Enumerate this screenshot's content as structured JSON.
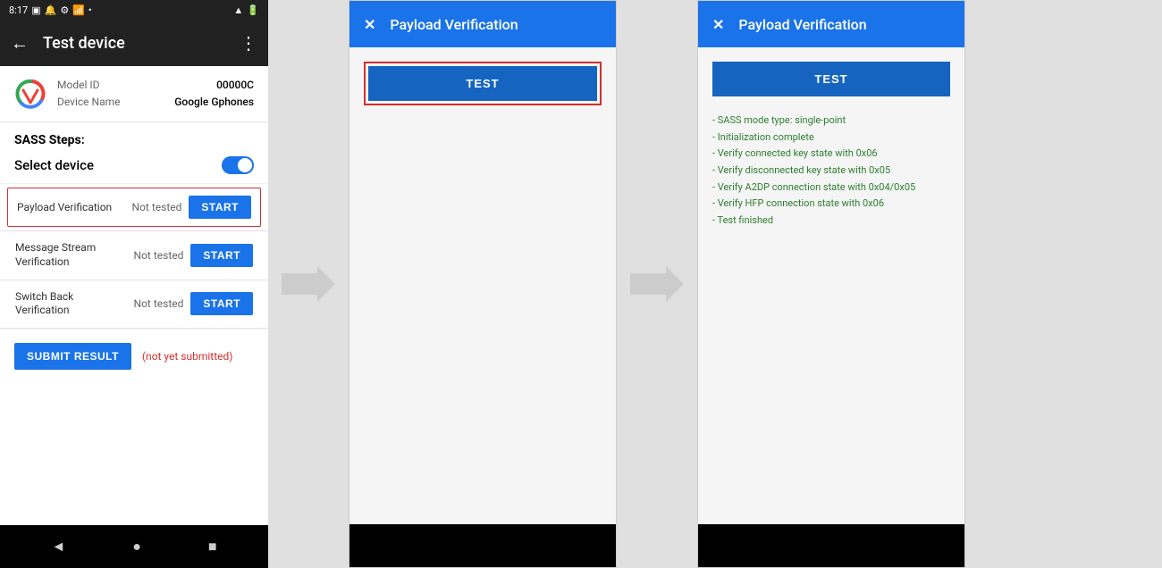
{
  "phone": {
    "status_bar": {
      "time": "8:17",
      "icons_left": [
        "sim",
        "notification",
        "settings",
        "signal"
      ],
      "icons_right": [
        "wifi",
        "battery"
      ]
    },
    "app_bar": {
      "back_icon": "←",
      "title": "Test device",
      "menu_icon": "⋮"
    },
    "device_info": {
      "model_label": "Model ID",
      "model_value": "00000C",
      "name_label": "Device Name",
      "name_value": "Google Gphones"
    },
    "sass_steps_label": "SASS Steps:",
    "select_device_label": "Select device",
    "steps": [
      {
        "name": "Payload Verification",
        "status": "Not tested",
        "btn_label": "START",
        "highlighted": true
      },
      {
        "name": "Message Stream Verification",
        "status": "Not tested",
        "btn_label": "START",
        "highlighted": false
      },
      {
        "name": "Switch Back Verification",
        "status": "Not tested",
        "btn_label": "START",
        "highlighted": false
      }
    ],
    "submit_btn_label": "SUBMIT RESULT",
    "submit_note": "(not yet submitted)",
    "nav": {
      "back": "◄",
      "home": "●",
      "recent": "■"
    }
  },
  "dialog1": {
    "header": {
      "close_icon": "✕",
      "title": "Payload Verification"
    },
    "test_btn_label": "TEST",
    "result_lines": []
  },
  "dialog2": {
    "header": {
      "close_icon": "✕",
      "title": "Payload Verification"
    },
    "test_btn_label": "TEST",
    "result_lines": [
      "- SASS mode type: single-point",
      "- Initialization complete",
      "- Verify connected key state with 0x06",
      "- Verify disconnected key state with 0x05",
      "- Verify A2DP connection state with 0x04/0x05",
      "- Verify HFP connection state with 0x06",
      "- Test finished"
    ]
  },
  "tested_label": "tested"
}
